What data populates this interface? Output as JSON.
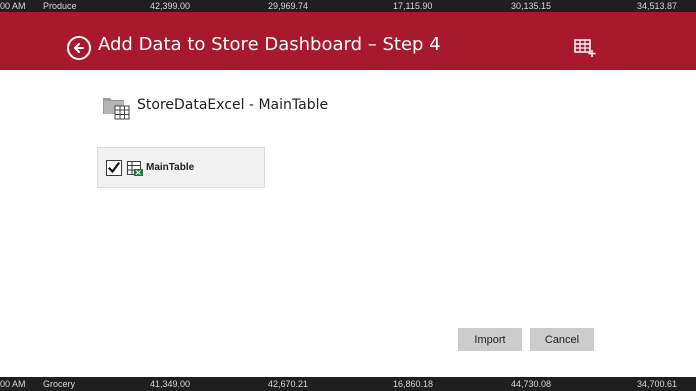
{
  "background_rows": {
    "top": [
      "00 AM",
      "Produce",
      "42,399.00",
      "29,969.74",
      "17,115.90",
      "30,135.15",
      "34,513.87"
    ],
    "bottom": [
      "00 AM",
      "Grocery",
      "41,349.00",
      "42,670.21",
      "16,860.18",
      "44,730.08",
      "34,700.61"
    ]
  },
  "header": {
    "title": "Add Data to Store Dashboard – Step 4",
    "back_icon": "back-arrow-circle-icon",
    "table_action_icon": "add-table-icon",
    "color": "#a8192e"
  },
  "source": {
    "icon": "folder-table-icon",
    "title": "StoreDataExcel - MainTable"
  },
  "tables": [
    {
      "label": "MainTable",
      "checked": true,
      "icon": "excel-table-icon"
    }
  ],
  "actions": {
    "import_label": "Import",
    "cancel_label": "Cancel"
  }
}
